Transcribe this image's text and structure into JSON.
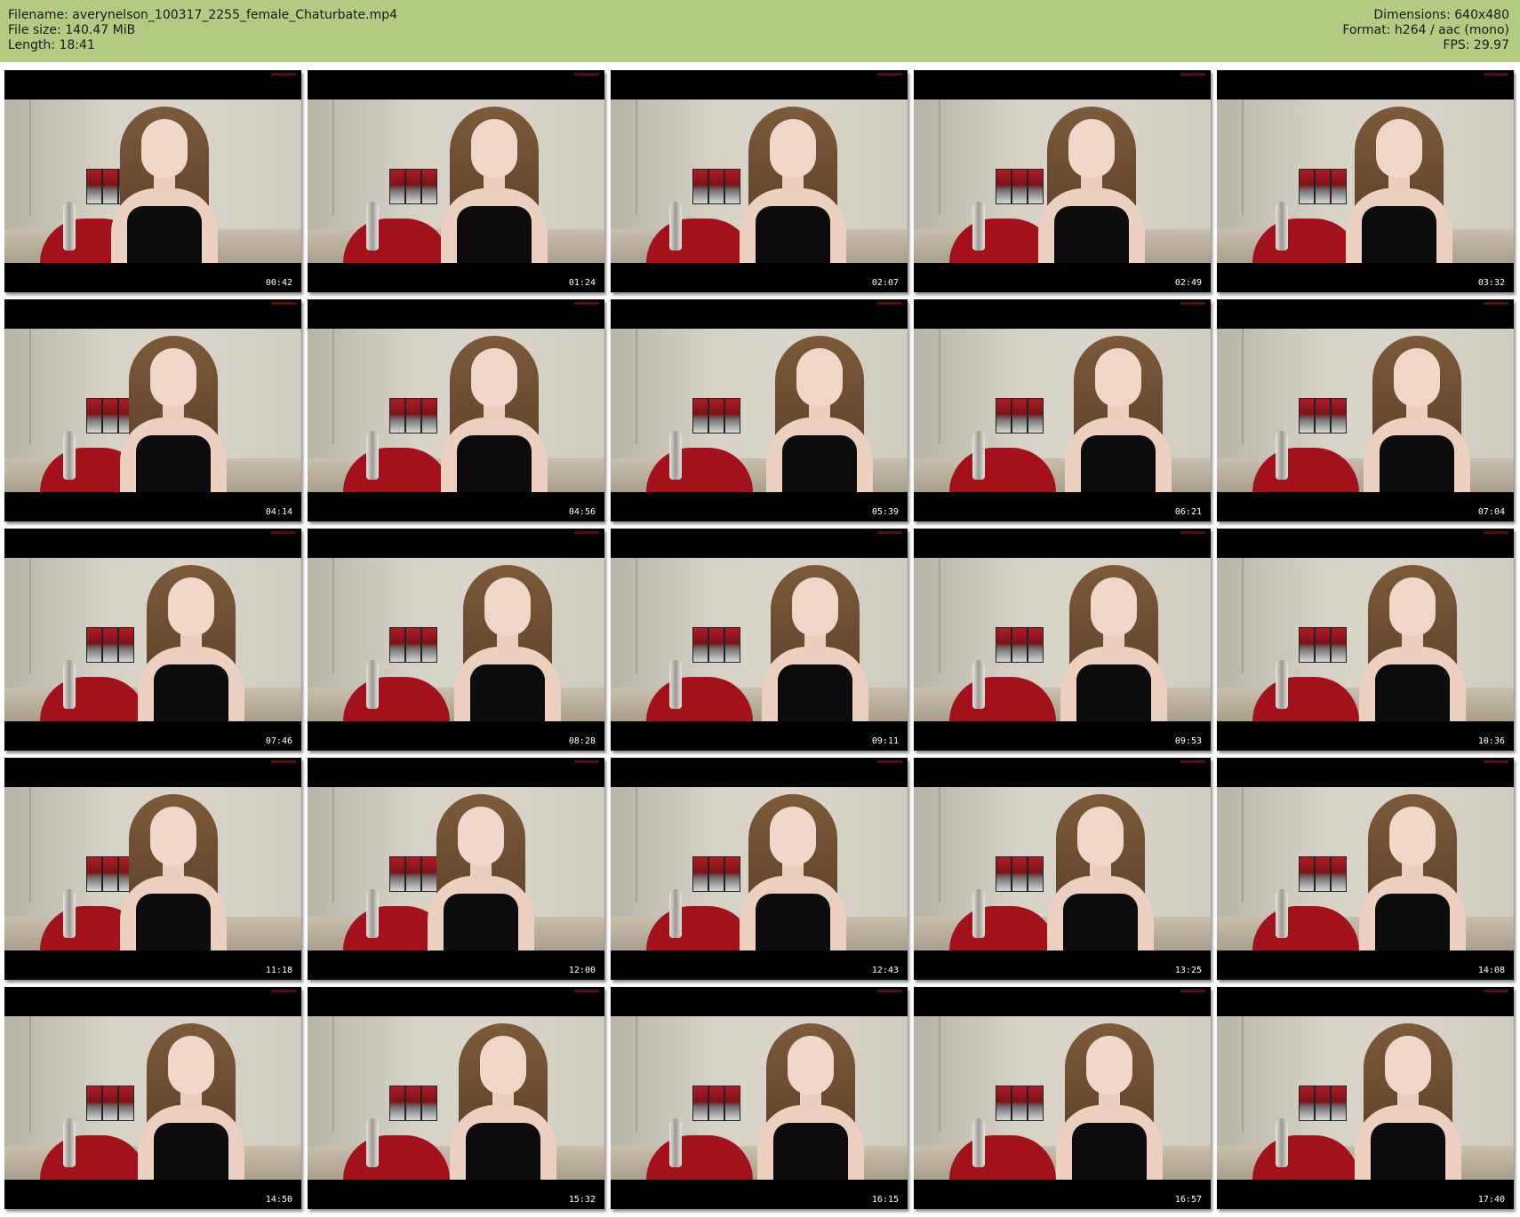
{
  "header": {
    "filename_line": "Filename: averynelson_100317_2255_female_Chaturbate.mp4",
    "filesize_line": "File size: 140.47 MiB",
    "length_line": "Length: 18:41",
    "dimensions_line": "Dimensions: 640x480",
    "format_line": "Format: h264 / aac (mono)",
    "fps_line": "FPS: 29.97"
  },
  "thumbnails": [
    {
      "time": "00:42"
    },
    {
      "time": "01:24"
    },
    {
      "time": "02:07"
    },
    {
      "time": "02:49"
    },
    {
      "time": "03:32"
    },
    {
      "time": "04:14"
    },
    {
      "time": "04:56"
    },
    {
      "time": "05:39"
    },
    {
      "time": "06:21"
    },
    {
      "time": "07:04"
    },
    {
      "time": "07:46"
    },
    {
      "time": "08:28"
    },
    {
      "time": "09:11"
    },
    {
      "time": "09:53"
    },
    {
      "time": "10:36"
    },
    {
      "time": "11:18"
    },
    {
      "time": "12:00"
    },
    {
      "time": "12:43"
    },
    {
      "time": "13:25"
    },
    {
      "time": "14:08"
    },
    {
      "time": "14:50"
    },
    {
      "time": "15:32"
    },
    {
      "time": "16:15"
    },
    {
      "time": "16:57"
    },
    {
      "time": "17:40"
    }
  ],
  "colors": {
    "header_background": "#b3cc82",
    "frame_background": "#000000"
  }
}
